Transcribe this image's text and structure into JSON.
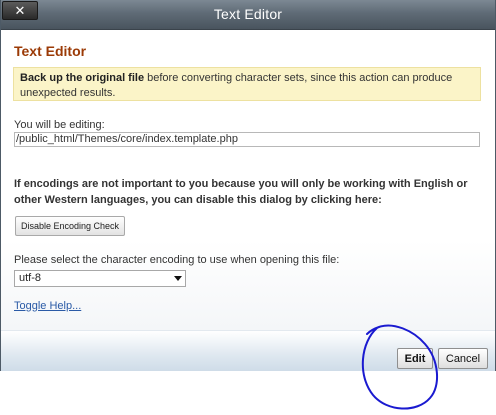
{
  "window": {
    "title": "Text Editor",
    "close_icon": "✕"
  },
  "main": {
    "heading": "Text Editor",
    "warning": {
      "bold_text": "Back up the original file",
      "rest_text": " before converting character sets, since this action can produce unexpected results."
    },
    "editing_label": "You will be editing:",
    "file_path": "/public_html/Themes/core/index.template.php",
    "encoding_note": "If encodings are not important to you because you will only be working with English or other Western languages, you can disable this dialog by clicking here:",
    "disable_button_label": "Disable Encoding Check",
    "select_label": "Please select the character encoding to use when opening this file:",
    "encoding_selected": "utf-8",
    "toggle_help_label": "Toggle Help..."
  },
  "footer": {
    "edit_label": "Edit",
    "cancel_label": "Cancel"
  },
  "colors": {
    "annotation": "#1a1ad0",
    "heading": "#9b3a06",
    "warning_bg": "#fbf4c8"
  }
}
